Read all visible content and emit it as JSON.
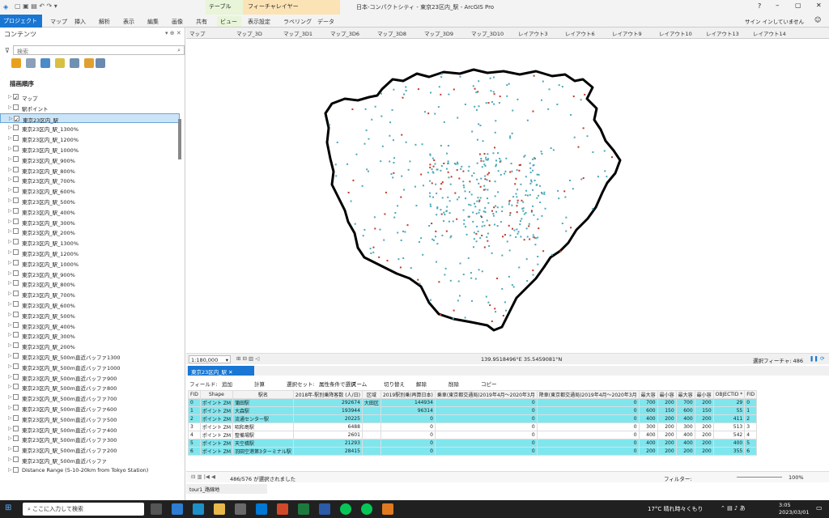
{
  "window": {
    "title": "日本-コンパクトシティ - 東京23区内_駅 - ArcGIS Pro",
    "context_groups": [
      {
        "label": "テーブル"
      },
      {
        "label": "フィーチャレイヤー"
      }
    ],
    "user": "サイン インしていません"
  },
  "ribbon_tabs": [
    "プロジェクト",
    "マップ",
    "挿入",
    "解析",
    "表示",
    "編集",
    "画像",
    "共有",
    "ビュー",
    "表示設定",
    "ラベリング",
    "データ"
  ],
  "contents": {
    "title": "コンテンツ",
    "search_placeholder": "検索",
    "section": "描画順序",
    "layers": [
      {
        "label": "マップ",
        "checked": true
      },
      {
        "label": "駅ポイント",
        "checked": false
      },
      {
        "label": "東京23区内_駅",
        "checked": true,
        "selected": true
      },
      {
        "label": "東京23区内_駅_1300%",
        "checked": false
      },
      {
        "label": "東京23区内_駅_1200%",
        "checked": false
      },
      {
        "label": "東京23区内_駅_1000%",
        "checked": false
      },
      {
        "label": "東京23区内_駅_900%",
        "checked": false
      },
      {
        "label": "東京23区内_駅_800%",
        "checked": false
      },
      {
        "label": "東京23区内_駅_700%",
        "checked": false
      },
      {
        "label": "東京23区内_駅_600%",
        "checked": false
      },
      {
        "label": "東京23区内_駅_500%",
        "checked": false
      },
      {
        "label": "東京23区内_駅_400%",
        "checked": false
      },
      {
        "label": "東京23区内_駅_300%",
        "checked": false
      },
      {
        "label": "東京23区内_駅_200%",
        "checked": false
      },
      {
        "label": "東京23区内_駅_1300%",
        "checked": false
      },
      {
        "label": "東京23区内_駅_1200%",
        "checked": false
      },
      {
        "label": "東京23区内_駅_1000%",
        "checked": false
      },
      {
        "label": "東京23区内_駅_900%",
        "checked": false
      },
      {
        "label": "東京23区内_駅_800%",
        "checked": false
      },
      {
        "label": "東京23区内_駅_700%",
        "checked": false
      },
      {
        "label": "東京23区内_駅_600%",
        "checked": false
      },
      {
        "label": "東京23区内_駅_500%",
        "checked": false
      },
      {
        "label": "東京23区内_駅_400%",
        "checked": false
      },
      {
        "label": "東京23区内_駅_300%",
        "checked": false
      },
      {
        "label": "東京23区内_駅_200%",
        "checked": false
      },
      {
        "label": "東京23区内_駅_500m直近バッファ1300",
        "checked": false
      },
      {
        "label": "東京23区内_駅_500m直近バッファ1000",
        "checked": false
      },
      {
        "label": "東京23区内_駅_500m直近バッファ900",
        "checked": false
      },
      {
        "label": "東京23区内_駅_500m直近バッファ800",
        "checked": false
      },
      {
        "label": "東京23区内_駅_500m直近バッファ700",
        "checked": false
      },
      {
        "label": "東京23区内_駅_500m直近バッファ600",
        "checked": false
      },
      {
        "label": "東京23区内_駅_500m直近バッファ500",
        "checked": false
      },
      {
        "label": "東京23区内_駅_500m直近バッファ400",
        "checked": false
      },
      {
        "label": "東京23区内_駅_500m直近バッファ300",
        "checked": false
      },
      {
        "label": "東京23区内_駅_500m直近バッファ200",
        "checked": false
      },
      {
        "label": "東京23区内_駅_500m直近バッファ",
        "checked": false
      },
      {
        "label": "Distance Range (5-10-20km from Tokyo Station)",
        "checked": false
      }
    ]
  },
  "map_tabs": [
    "マップ",
    "マップ_3D",
    "マップ_3D1",
    "マップ_3D6",
    "マップ_3D8",
    "マップ_3D9",
    "マップ_3D10",
    "レイアウト3",
    "レイアウト6",
    "レイアウト9",
    "レイアウト10",
    "レイアウト13",
    "レイアウト14"
  ],
  "map_status": {
    "scale": "1:180,000",
    "coords": "139.9518496°E 35.5459081°N",
    "selected_features": "選択フィーチャ: 486"
  },
  "table": {
    "tab_label": "東京23区内_駅",
    "toolbar": [
      "フィールド:",
      "追加",
      "計算",
      "選択セット:",
      "属性条件で選択",
      "ズーム",
      "切り替え",
      "解除",
      "削除",
      "コピー"
    ],
    "columns": [
      "FID",
      "Shape",
      "駅名",
      "2018年-駅別乗降客数 (人/日)",
      "区域",
      "2019駅別乗(再算日本)",
      "乗車(東京都交通局)2019年4月～2020年3月",
      "降車(東京都交通局)2019年4月～2020年3月",
      "最大容",
      "最小容",
      "最大容",
      "最小容",
      "OBJECTID *",
      "FID"
    ],
    "rows": [
      {
        "sel": true,
        "cells": [
          "0",
          "ポイント ZM",
          "蒲田駅",
          "292674",
          "大田区",
          "144934",
          "0",
          "0",
          "700",
          "200",
          "700",
          "200",
          "29",
          "0"
        ]
      },
      {
        "sel": true,
        "cells": [
          "1",
          "ポイント ZM",
          "大森駅",
          "193944",
          "",
          "96314",
          "0",
          "0",
          "600",
          "150",
          "600",
          "150",
          "55",
          "1"
        ]
      },
      {
        "sel": true,
        "cells": [
          "2",
          "ポイント ZM",
          "流通センター駅",
          "20225",
          "",
          "0",
          "0",
          "0",
          "400",
          "200",
          "400",
          "200",
          "411",
          "2"
        ]
      },
      {
        "sel": false,
        "cells": [
          "3",
          "ポイント ZM",
          "昭和島駅",
          "6488",
          "",
          "0",
          "0",
          "0",
          "300",
          "200",
          "300",
          "200",
          "513",
          "3"
        ]
      },
      {
        "sel": false,
        "cells": [
          "4",
          "ポイント ZM",
          "整備場駅",
          "2601",
          "",
          "0",
          "0",
          "0",
          "400",
          "200",
          "400",
          "200",
          "542",
          "4"
        ]
      },
      {
        "sel": true,
        "cells": [
          "5",
          "ポイント ZM",
          "天空橋駅",
          "21293",
          "",
          "0",
          "0",
          "0",
          "400",
          "200",
          "400",
          "200",
          "400",
          "5"
        ]
      },
      {
        "sel": true,
        "cells": [
          "6",
          "ポイント ZM",
          "羽田空港第3ターミナル駅",
          "28415",
          "",
          "0",
          "0",
          "0",
          "200",
          "200",
          "200",
          "200",
          "355",
          "6"
        ]
      }
    ],
    "footer_count": "486/576 が選択されました",
    "filter_label": "フィルター:",
    "zoom": "100%"
  },
  "bottom_tab": "tour1_路線地",
  "taskbar": {
    "search": "ここに入力して検索",
    "weather": "17°C 晴れ時々くもり",
    "time": "3:05",
    "date": "2023/03/01"
  },
  "colors": {
    "accent": "#1976d2",
    "highlight": "#7fe6ee",
    "station_blue": "#4aa8b8",
    "station_red": "#c0392b"
  }
}
